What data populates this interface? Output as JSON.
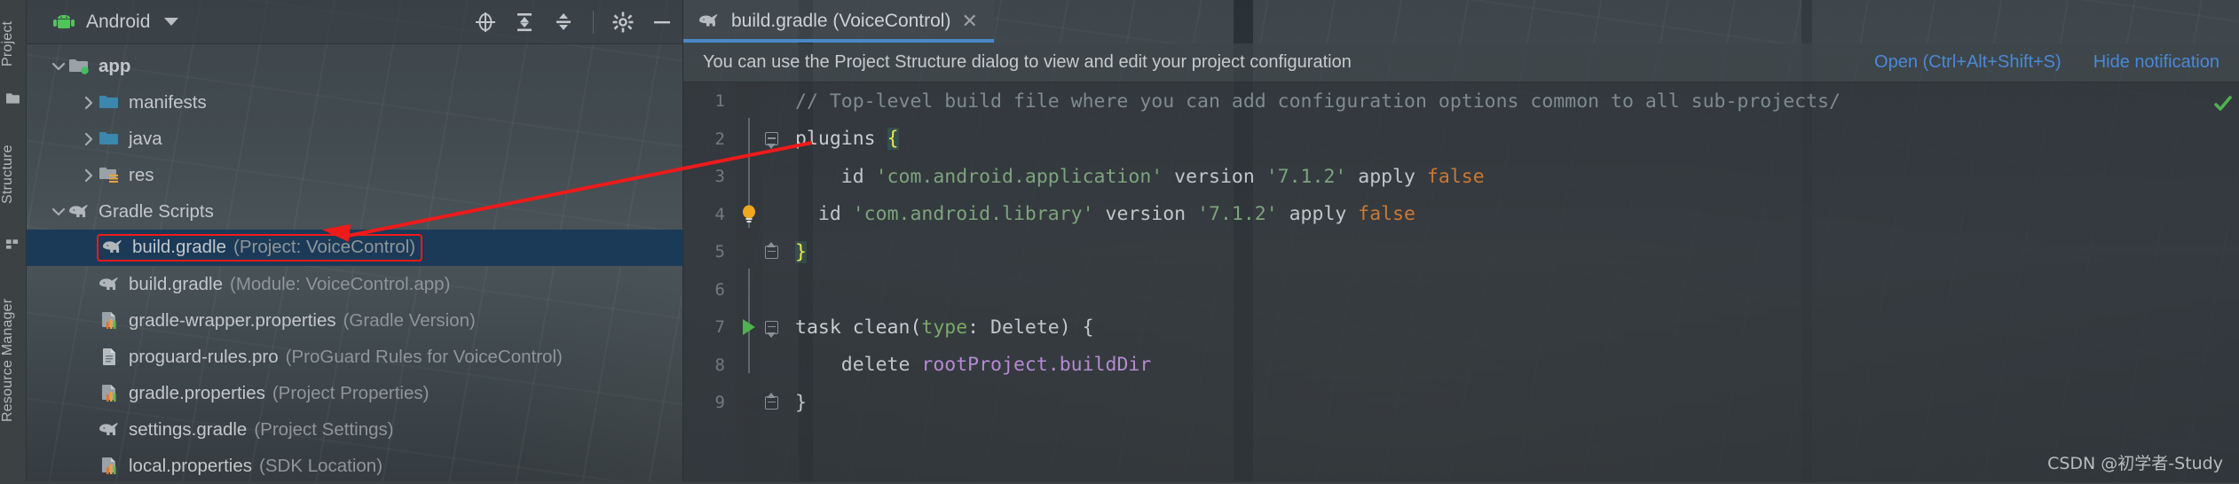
{
  "left_rail": {
    "items": [
      {
        "label": "Project",
        "icon": "project-icon"
      },
      {
        "label": "Structure",
        "icon": "structure-icon"
      },
      {
        "label": "Resource Manager",
        "icon": "resource-manager-icon"
      }
    ]
  },
  "project_panel": {
    "header": {
      "title": "Android",
      "icon": "android-robot-icon",
      "dropdown_icon": "chevron-down-icon",
      "tools": [
        {
          "name": "locate-icon",
          "title": "Select Opened File"
        },
        {
          "name": "expand-all-icon",
          "title": "Expand All"
        },
        {
          "name": "collapse-all-icon",
          "title": "Collapse All"
        },
        {
          "name": "gear-icon",
          "title": "Settings"
        },
        {
          "name": "minimize-icon",
          "title": "Hide"
        }
      ]
    },
    "tree": [
      {
        "name": "app",
        "detail": "",
        "indent": 0,
        "arrow": "expanded",
        "icon": "module-folder-icon",
        "bold": true,
        "selected": false
      },
      {
        "name": "manifests",
        "detail": "",
        "indent": 1,
        "arrow": "collapsed",
        "icon": "blue-folder-icon",
        "bold": false,
        "selected": false
      },
      {
        "name": "java",
        "detail": "",
        "indent": 1,
        "arrow": "collapsed",
        "icon": "blue-folder-icon",
        "bold": false,
        "selected": false
      },
      {
        "name": "res",
        "detail": "",
        "indent": 1,
        "arrow": "collapsed",
        "icon": "res-folder-icon",
        "bold": false,
        "selected": false
      },
      {
        "name": "Gradle Scripts",
        "detail": "",
        "indent": 0,
        "arrow": "expanded",
        "icon": "gradle-elephant-icon",
        "bold": false,
        "selected": false
      },
      {
        "name": "build.gradle",
        "detail": "(Project: VoiceControl)",
        "indent": 1,
        "arrow": "none",
        "icon": "gradle-elephant-icon",
        "bold": false,
        "selected": true,
        "highlighted": true
      },
      {
        "name": "build.gradle",
        "detail": "(Module: VoiceControl.app)",
        "indent": 1,
        "arrow": "none",
        "icon": "gradle-elephant-icon",
        "bold": false,
        "selected": false
      },
      {
        "name": "gradle-wrapper.properties",
        "detail": "(Gradle Version)",
        "indent": 1,
        "arrow": "none",
        "icon": "properties-icon",
        "bold": false,
        "selected": false
      },
      {
        "name": "proguard-rules.pro",
        "detail": "(ProGuard Rules for VoiceControl)",
        "indent": 1,
        "arrow": "none",
        "icon": "text-file-icon",
        "bold": false,
        "selected": false
      },
      {
        "name": "gradle.properties",
        "detail": "(Project Properties)",
        "indent": 1,
        "arrow": "none",
        "icon": "properties-icon",
        "bold": false,
        "selected": false
      },
      {
        "name": "settings.gradle",
        "detail": "(Project Settings)",
        "indent": 1,
        "arrow": "none",
        "icon": "gradle-elephant-icon",
        "bold": false,
        "selected": false
      },
      {
        "name": "local.properties",
        "detail": "(SDK Location)",
        "indent": 1,
        "arrow": "none",
        "icon": "properties-icon",
        "bold": false,
        "selected": false
      }
    ]
  },
  "editor": {
    "tab": {
      "title": "build.gradle (VoiceControl)",
      "icon": "gradle-elephant-icon",
      "close_icon": "close-icon"
    },
    "notification": {
      "message": "You can use the Project Structure dialog to view and edit your project configuration",
      "open_link": "Open (Ctrl+Alt+Shift+S)",
      "hide_link": "Hide notification"
    },
    "inspection_status": "ok-check-icon",
    "code": [
      {
        "ln": "1",
        "gutter": "",
        "fold": "none",
        "tokens": [
          {
            "t": "// Top-level build file where you can add configuration options common to all sub-projects/",
            "c": "c-com"
          }
        ]
      },
      {
        "ln": "2",
        "gutter": "",
        "fold": "down",
        "tokens": [
          {
            "t": "plugins ",
            "c": "c-kw"
          },
          {
            "t": "{",
            "c": "c-brace"
          }
        ]
      },
      {
        "ln": "3",
        "gutter": "",
        "fold": "none",
        "tokens": [
          {
            "t": "    id ",
            "c": "c-plain"
          },
          {
            "t": "'com.android.application'",
            "c": "c-str"
          },
          {
            "t": " version ",
            "c": "c-plain"
          },
          {
            "t": "'7.1.2'",
            "c": "c-num"
          },
          {
            "t": " apply ",
            "c": "c-plain"
          },
          {
            "t": "false",
            "c": "c-false"
          }
        ]
      },
      {
        "ln": "4",
        "gutter": "bulb",
        "fold": "none",
        "tokens": [
          {
            "t": "  id ",
            "c": "c-plain"
          },
          {
            "t": "'com.android.library'",
            "c": "c-str"
          },
          {
            "t": " version ",
            "c": "c-plain"
          },
          {
            "t": "'7.1.2'",
            "c": "c-num"
          },
          {
            "t": " apply ",
            "c": "c-plain"
          },
          {
            "t": "false",
            "c": "c-false"
          }
        ]
      },
      {
        "ln": "5",
        "gutter": "",
        "fold": "up",
        "tokens": [
          {
            "t": "}",
            "c": "c-brace"
          }
        ]
      },
      {
        "ln": "6",
        "gutter": "",
        "fold": "none",
        "tokens": []
      },
      {
        "ln": "7",
        "gutter": "run",
        "fold": "down",
        "tokens": [
          {
            "t": "task clean(",
            "c": "c-kw"
          },
          {
            "t": "type",
            "c": "c-type"
          },
          {
            "t": ": Delete) {",
            "c": "c-plain"
          }
        ]
      },
      {
        "ln": "8",
        "gutter": "",
        "fold": "none",
        "tokens": [
          {
            "t": "    delete ",
            "c": "c-plain"
          },
          {
            "t": "rootProject.buildDir",
            "c": "c-prop"
          }
        ]
      },
      {
        "ln": "9",
        "gutter": "",
        "fold": "up",
        "tokens": [
          {
            "t": "}",
            "c": "c-plain"
          }
        ]
      }
    ]
  },
  "watermark": "CSDN @初学者-Study",
  "colors": {
    "selection": "#1b3a57",
    "annotation_red": "#f01a1a",
    "link_blue": "#4a88d8",
    "tab_underline": "#4a88c7",
    "android_green": "#52c45c",
    "string_green": "#7da47d",
    "keyword_orange": "#cc7832",
    "property_purple": "#b58ad4"
  }
}
